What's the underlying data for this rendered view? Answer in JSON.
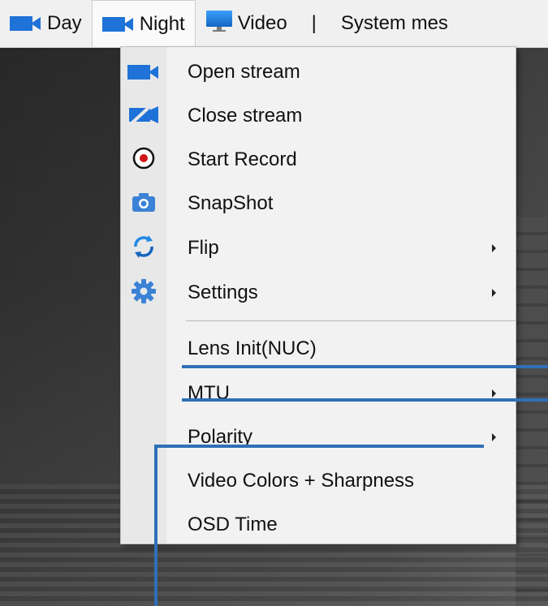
{
  "menubar": {
    "items": [
      {
        "label": "Day",
        "icon": "camera-icon"
      },
      {
        "label": "Night",
        "icon": "camera-icon"
      },
      {
        "label": "Video",
        "icon": "monitor-icon"
      }
    ],
    "separator": "|",
    "system_label": "System mes"
  },
  "dropdown": {
    "items": [
      {
        "label": "Open stream",
        "icon": "camera-icon"
      },
      {
        "label": "Close stream",
        "icon": "camera-off-icon"
      },
      {
        "label": "Start Record",
        "icon": "record-icon"
      },
      {
        "label": "SnapShot",
        "icon": "photo-camera-icon"
      },
      {
        "label": "Flip",
        "icon": "rotate-icon"
      },
      {
        "label": "Settings",
        "icon": "gear-icon"
      },
      {
        "label": "Lens Init(NUC)"
      },
      {
        "label": "MTU"
      },
      {
        "label": "Polarity"
      },
      {
        "label": "Video Colors + Sharpness"
      },
      {
        "label": "OSD Time"
      }
    ]
  },
  "colors": {
    "accent": "#1e72d8",
    "annotation": "#2f6fb8",
    "menu_bg": "#f2f2f2"
  }
}
